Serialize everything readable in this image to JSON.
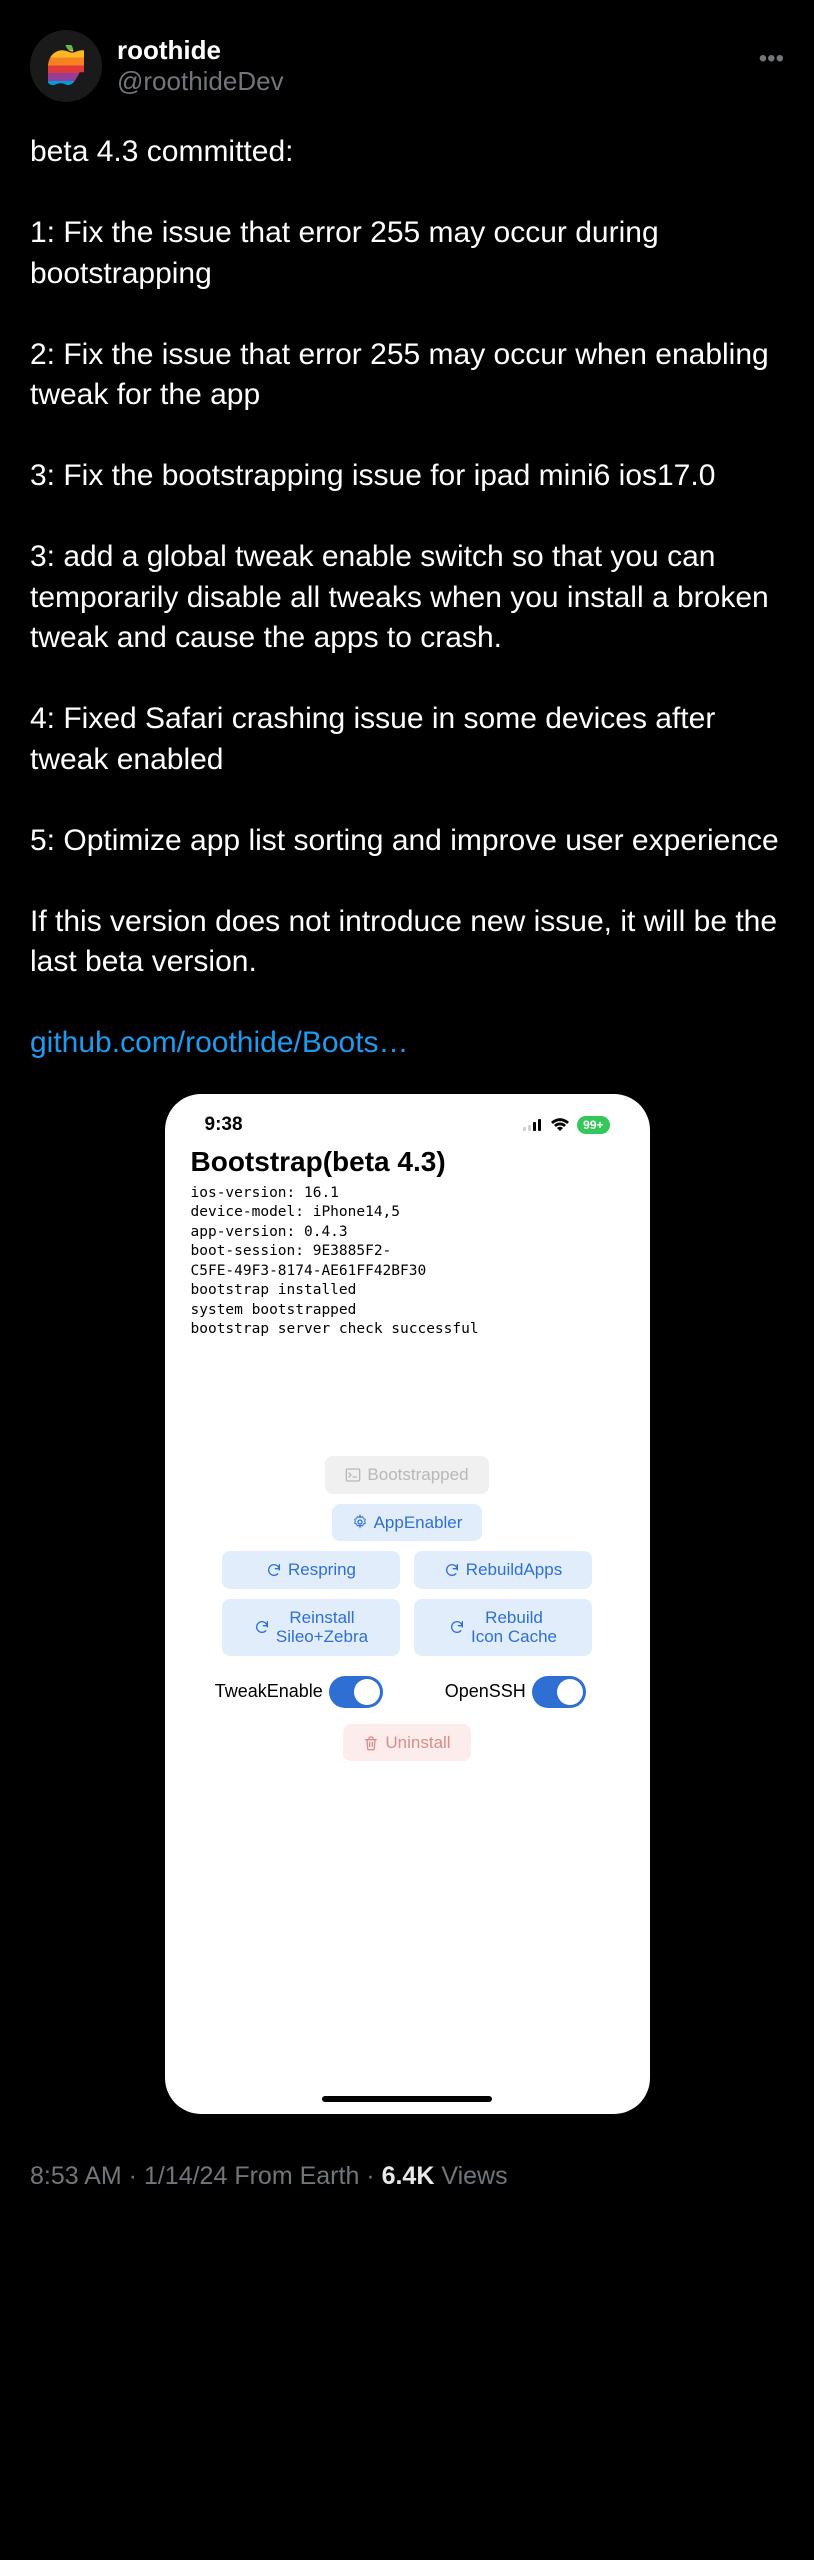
{
  "author": {
    "display_name": "roothide",
    "handle": "@roothideDev"
  },
  "post": {
    "text": "beta 4.3 committed:\n\n1: Fix the issue that error 255 may occur during bootstrapping\n\n2: Fix the issue that error 255 may occur when enabling tweak for the app\n\n3: Fix the bootstrapping issue for ipad mini6 ios17.0\n\n3: add a global tweak enable switch so that you can temporarily disable all tweaks when you install a broken tweak and cause the apps to crash.\n\n4: Fixed Safari crashing issue in some devices after tweak enabled\n\n5: Optimize app list sorting and improve user experience\n\nIf this version does not introduce new issue, it will be the last beta version.\n\n",
    "link_text": "github.com/roothide/Boots…"
  },
  "phone": {
    "time": "9:38",
    "battery_badge": "99+",
    "title": "Bootstrap(beta 4.3)",
    "log": "ios-version: 16.1\ndevice-model: iPhone14,5\napp-version: 0.4.3\nboot-session: 9E3885F2-\nC5FE-49F3-8174-AE61FF42BF30\nbootstrap installed\nsystem bootstrapped\nbootstrap server check successful",
    "buttons": {
      "bootstrapped": "Bootstrapped",
      "appenabler": "AppEnabler",
      "respring": "Respring",
      "rebuildapps": "RebuildApps",
      "reinstall": "Reinstall\nSileo+Zebra",
      "rebuildicon": "Rebuild\nIcon Cache",
      "tweakenable": "TweakEnable",
      "openssh": "OpenSSH",
      "uninstall": "Uninstall"
    }
  },
  "footer": {
    "time": "8:53 AM",
    "date": "1/14/24",
    "source": "From Earth",
    "views_count": "6.4K",
    "views_suffix": "Views"
  }
}
